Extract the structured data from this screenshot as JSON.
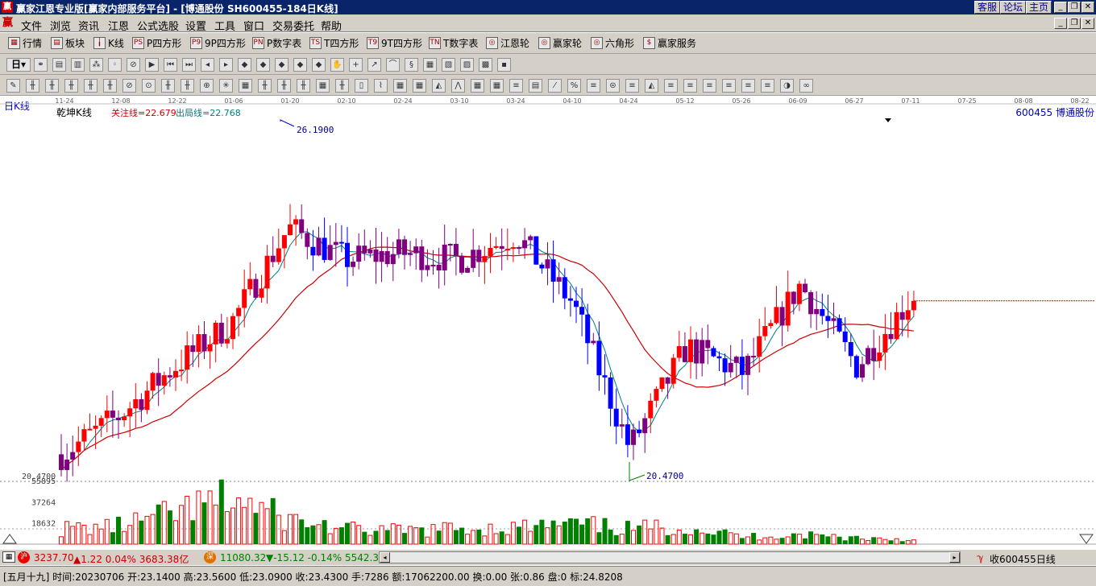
{
  "window": {
    "title": "赢家江恩专业版[赢家内部服务平台] - [博通股份  SH600455-184日K线]",
    "links": [
      "客服",
      "论坛",
      "主页"
    ]
  },
  "menu": [
    "文件",
    "浏览",
    "资讯",
    "江恩",
    "公式选股",
    "设置",
    "工具",
    "窗口",
    "交易委托",
    "帮助"
  ],
  "toolbar1": [
    {
      "label": "行情",
      "icon": "grid-icon"
    },
    {
      "label": "板块",
      "icon": "blocks-icon"
    },
    {
      "label": "K线",
      "icon": "candles-icon"
    },
    {
      "label": "P四方形",
      "icon": "ps-icon",
      "tag": "PS"
    },
    {
      "label": "9P四方形",
      "icon": "p9-icon",
      "tag": "P9"
    },
    {
      "label": "P数字表",
      "icon": "pn-icon",
      "tag": "PN"
    },
    {
      "label": "T四方形",
      "icon": "ts-icon",
      "tag": "TS"
    },
    {
      "label": "9T四方形",
      "icon": "t9-icon",
      "tag": "T9"
    },
    {
      "label": "T数字表",
      "icon": "tn-icon",
      "tag": "TN"
    },
    {
      "label": "江恩轮",
      "icon": "wheel-icon",
      "tag": "◎"
    },
    {
      "label": "赢家轮",
      "icon": "winner-wheel-icon",
      "tag": "◎"
    },
    {
      "label": "六角形",
      "icon": "hexagon-icon",
      "tag": "◎"
    },
    {
      "label": "赢家服务",
      "icon": "dollar-icon",
      "tag": "$"
    }
  ],
  "period_selector": "日",
  "chart_header": {
    "period_label": "日K线",
    "indicator_name": "乾坤K线",
    "watch_line": "关注线=22.679",
    "exit_line": "出局线=22.768",
    "stock": "600455  博通股份",
    "high_label": "26.1900",
    "low_label": "20.4700",
    "low_axis": "20.4700",
    "vol_axis": [
      "55895",
      "37264",
      "18632"
    ]
  },
  "date_axis": [
    "11-24",
    "12-08",
    "12-22",
    "01-06",
    "01-20",
    "02-10",
    "02-24",
    "03-10",
    "03-24",
    "04-10",
    "04-24",
    "05-12",
    "05-26",
    "06-09",
    "06-27",
    "07-11",
    "07-25",
    "08-08",
    "08-22"
  ],
  "status1": {
    "sh_index": "3237.70",
    "sh_change": "▲1.22 0.04% 3683.38亿",
    "sz_index": "11080.32",
    "sz_change": "▼-15.12 -0.14% 5542.3",
    "right_text": "收600455日线"
  },
  "status2": {
    "text": "[五月十九] 时间:20230706 开:23.1400 高:23.5600 低:23.0900 收:23.4300 手:7286 额:17062200.00 换:0.00 张:0.86 盘:0 标:24.8208"
  },
  "colors": {
    "up": "#ff0000",
    "down": "#0000ff",
    "neutral": "#800080",
    "ma_slow": "#cc0000",
    "ma_fast": "#008080",
    "volume": "#008000"
  },
  "chart_data": {
    "type": "candlestick",
    "ylim": [
      20.47,
      26.19
    ],
    "x": [
      "11-24",
      "12-08",
      "12-22",
      "01-06",
      "01-20",
      "02-10",
      "02-24",
      "03-10",
      "03-24",
      "04-10",
      "04-24",
      "05-12",
      "05-26",
      "06-09",
      "06-27",
      "07-11"
    ],
    "close_approx": [
      20.9,
      21.5,
      22.3,
      23.0,
      24.5,
      24.0,
      24.1,
      24.0,
      24.4,
      23.3,
      21.0,
      22.6,
      22.2,
      23.6,
      22.3,
      23.43
    ],
    "volume_approx": [
      18632,
      22000,
      37264,
      55895,
      30000,
      18000,
      16000,
      19000,
      20000,
      24000,
      19000,
      21000,
      9000,
      12000,
      8000,
      5000
    ],
    "volume_axis": [
      18632,
      37264,
      55895
    ]
  }
}
